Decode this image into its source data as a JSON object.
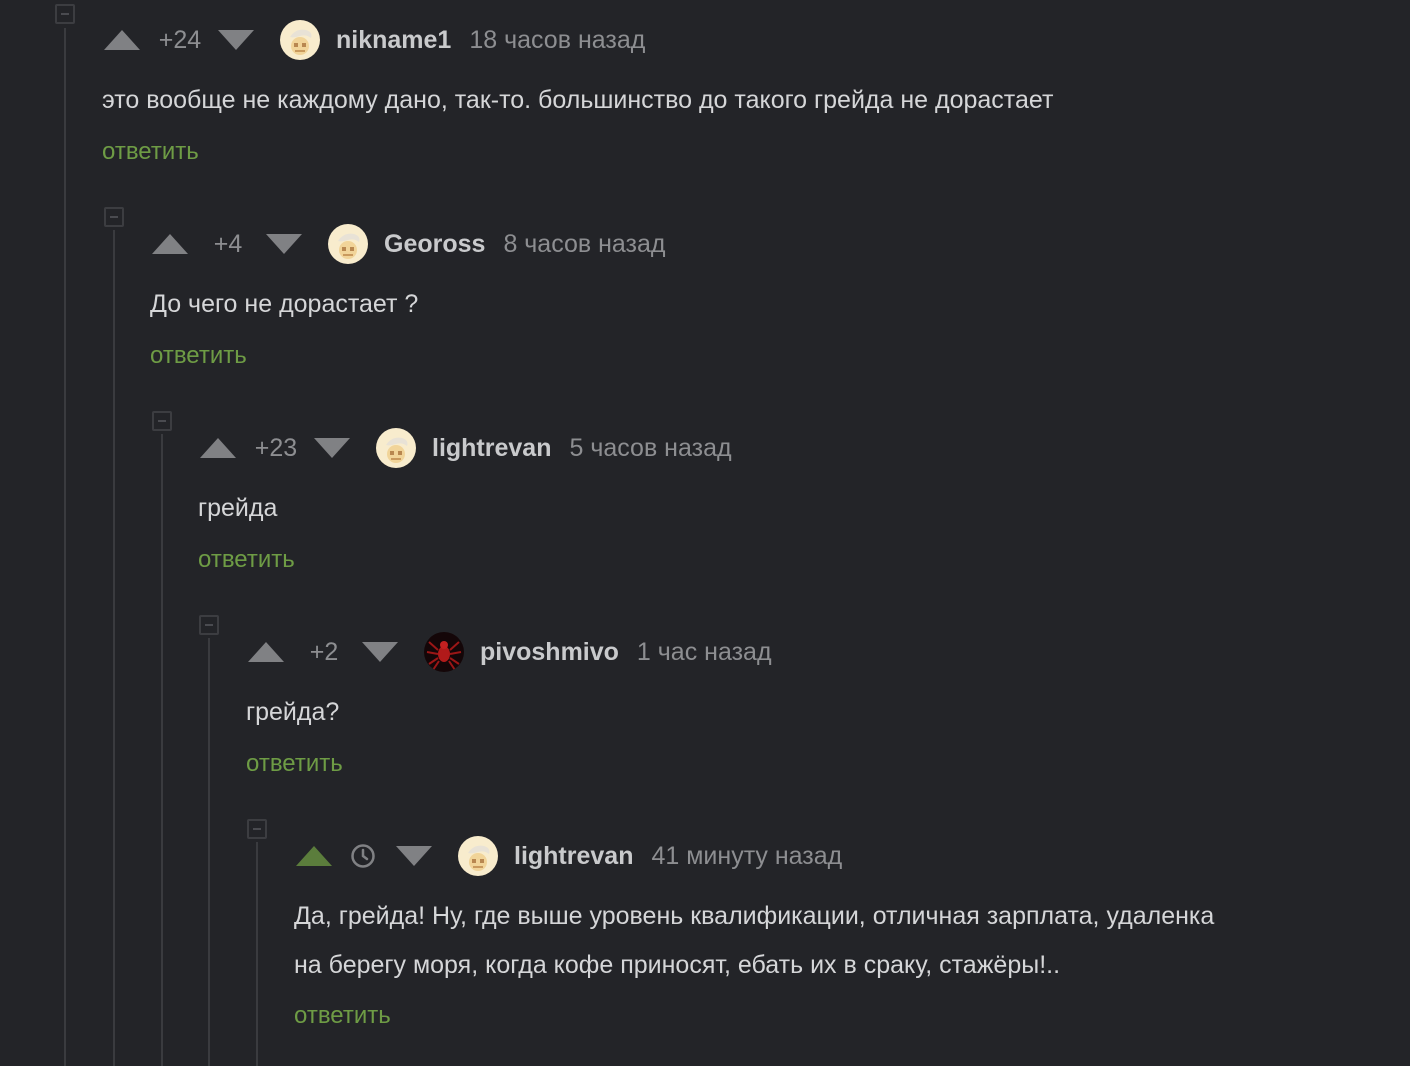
{
  "colors": {
    "background": "#232428",
    "text": "#d5d6d8",
    "meta": "#8d8e91",
    "author": "#c9cacc",
    "reply": "#6e9c45",
    "vote_active": "#5b7d3c",
    "vote_idle": "#808184"
  },
  "comments": [
    {
      "rating": "+24",
      "author": "nikname1",
      "time": "18 часов назад",
      "avatar_icon": "default-avatar-icon",
      "text_lines": [
        "это вообще не каждому дано, так-то. большинство до такого грейда не дорастает"
      ],
      "reply_label": "ответить"
    },
    {
      "rating": "+4",
      "author": "Geoross",
      "time": "8 часов назад",
      "avatar_icon": "default-avatar-icon",
      "text_lines": [
        "До чего не дорастает ?"
      ],
      "reply_label": "ответить"
    },
    {
      "rating": "+23",
      "author": "lightrevan",
      "time": "5 часов назад",
      "avatar_icon": "default-avatar-icon",
      "text_lines": [
        "грейда"
      ],
      "reply_label": "ответить"
    },
    {
      "rating": "+2",
      "author": "pivoshmivo",
      "time": "1 час назад",
      "avatar_icon": "spider-avatar-icon",
      "text_lines": [
        "грейда?"
      ],
      "reply_label": "ответить"
    },
    {
      "rating": "",
      "rating_icon": "clock-icon",
      "upvoted": true,
      "author": "lightrevan",
      "time": "41 минуту назад",
      "avatar_icon": "default-avatar-icon",
      "text_lines": [
        "Да, грейда! Ну, где выше уровень квалификации, отличная зарплата, удаленка",
        "на берегу моря, когда кофе приносят, ебать их в сраку, стажёры!.."
      ],
      "reply_label": "ответить"
    }
  ]
}
